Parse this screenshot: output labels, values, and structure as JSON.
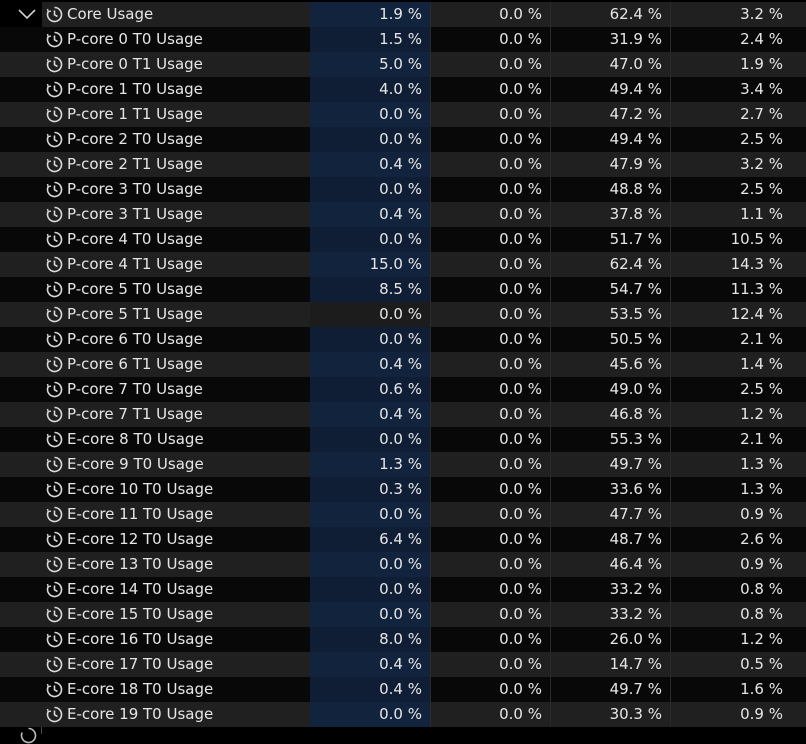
{
  "group": {
    "label": "Core Usage",
    "current": "1.9 %",
    "min": "0.0 %",
    "max": "62.4 %",
    "avg": "3.2 %"
  },
  "rows": [
    {
      "label": "P-core 0 T0 Usage",
      "current": "1.5 %",
      "min": "0.0 %",
      "max": "31.9 %",
      "avg": "2.4 %"
    },
    {
      "label": "P-core 0 T1 Usage",
      "current": "5.0 %",
      "min": "0.0 %",
      "max": "47.0 %",
      "avg": "1.9 %"
    },
    {
      "label": "P-core 1 T0 Usage",
      "current": "4.0 %",
      "min": "0.0 %",
      "max": "49.4 %",
      "avg": "3.4 %"
    },
    {
      "label": "P-core 1 T1 Usage",
      "current": "0.0 %",
      "min": "0.0 %",
      "max": "47.2 %",
      "avg": "2.7 %"
    },
    {
      "label": "P-core 2 T0 Usage",
      "current": "0.0 %",
      "min": "0.0 %",
      "max": "49.4 %",
      "avg": "2.5 %"
    },
    {
      "label": "P-core 2 T1 Usage",
      "current": "0.4 %",
      "min": "0.0 %",
      "max": "47.9 %",
      "avg": "3.2 %"
    },
    {
      "label": "P-core 3 T0 Usage",
      "current": "0.0 %",
      "min": "0.0 %",
      "max": "48.8 %",
      "avg": "2.5 %"
    },
    {
      "label": "P-core 3 T1 Usage",
      "current": "0.4 %",
      "min": "0.0 %",
      "max": "37.8 %",
      "avg": "1.1 %"
    },
    {
      "label": "P-core 4 T0 Usage",
      "current": "0.0 %",
      "min": "0.0 %",
      "max": "51.7 %",
      "avg": "10.5 %"
    },
    {
      "label": "P-core 4 T1 Usage",
      "current": "15.0 %",
      "min": "0.0 %",
      "max": "62.4 %",
      "avg": "14.3 %"
    },
    {
      "label": "P-core 5 T0 Usage",
      "current": "8.5 %",
      "min": "0.0 %",
      "max": "54.7 %",
      "avg": "11.3 %"
    },
    {
      "label": "P-core 5 T1 Usage",
      "current": "0.0 %",
      "min": "0.0 %",
      "max": "53.5 %",
      "avg": "12.4 %"
    },
    {
      "label": "P-core 6 T0 Usage",
      "current": "0.0 %",
      "min": "0.0 %",
      "max": "50.5 %",
      "avg": "2.1 %"
    },
    {
      "label": "P-core 6 T1 Usage",
      "current": "0.4 %",
      "min": "0.0 %",
      "max": "45.6 %",
      "avg": "1.4 %"
    },
    {
      "label": "P-core 7 T0 Usage",
      "current": "0.6 %",
      "min": "0.0 %",
      "max": "49.0 %",
      "avg": "2.5 %"
    },
    {
      "label": "P-core 7 T1 Usage",
      "current": "0.4 %",
      "min": "0.0 %",
      "max": "46.8 %",
      "avg": "1.2 %"
    },
    {
      "label": "E-core 8 T0 Usage",
      "current": "0.0 %",
      "min": "0.0 %",
      "max": "55.3 %",
      "avg": "2.1 %"
    },
    {
      "label": "E-core 9 T0 Usage",
      "current": "1.3 %",
      "min": "0.0 %",
      "max": "49.7 %",
      "avg": "1.3 %"
    },
    {
      "label": "E-core 10 T0 Usage",
      "current": "0.3 %",
      "min": "0.0 %",
      "max": "33.6 %",
      "avg": "1.3 %"
    },
    {
      "label": "E-core 11 T0 Usage",
      "current": "0.0 %",
      "min": "0.0 %",
      "max": "47.7 %",
      "avg": "0.9 %"
    },
    {
      "label": "E-core 12 T0 Usage",
      "current": "6.4 %",
      "min": "0.0 %",
      "max": "48.7 %",
      "avg": "2.6 %"
    },
    {
      "label": "E-core 13 T0 Usage",
      "current": "0.0 %",
      "min": "0.0 %",
      "max": "46.4 %",
      "avg": "0.9 %"
    },
    {
      "label": "E-core 14 T0 Usage",
      "current": "0.0 %",
      "min": "0.0 %",
      "max": "33.2 %",
      "avg": "0.8 %"
    },
    {
      "label": "E-core 15 T0 Usage",
      "current": "0.0 %",
      "min": "0.0 %",
      "max": "33.2 %",
      "avg": "0.8 %"
    },
    {
      "label": "E-core 16 T0 Usage",
      "current": "8.0 %",
      "min": "0.0 %",
      "max": "26.0 %",
      "avg": "1.2 %"
    },
    {
      "label": "E-core 17 T0 Usage",
      "current": "0.4 %",
      "min": "0.0 %",
      "max": "14.7 %",
      "avg": "0.5 %"
    },
    {
      "label": "E-core 18 T0 Usage",
      "current": "0.4 %",
      "min": "0.0 %",
      "max": "49.7 %",
      "avg": "1.6 %"
    },
    {
      "label": "E-core 19 T0 Usage",
      "current": "0.0 %",
      "min": "0.0 %",
      "max": "30.3 %",
      "avg": "0.9 %"
    }
  ],
  "selected_row_index": 11,
  "icons": {
    "group_toggle": "chevron-down-icon",
    "sensor": "clock-icon"
  },
  "colors": {
    "current_column": "#12233d",
    "row_light": "#202020",
    "row_dark": "#080808"
  }
}
